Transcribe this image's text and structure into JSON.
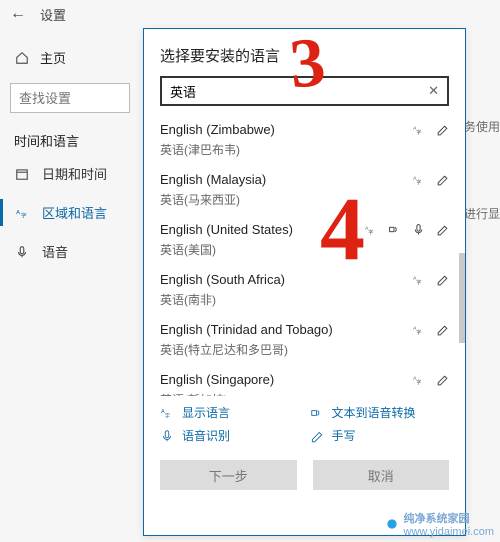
{
  "topbar": {
    "title": "设置"
  },
  "sidebar": {
    "home_label": "主页",
    "search_placeholder": "查找设置",
    "section_title": "时间和语言",
    "items": [
      {
        "label": "日期和时间"
      },
      {
        "label": "区域和语言"
      },
      {
        "label": "语音"
      }
    ]
  },
  "right_hints": {
    "a": "务使用",
    "b": "进行显"
  },
  "dialog": {
    "title": "选择要安装的语言",
    "search_value": "英语",
    "results": [
      {
        "name_en": "English (Zimbabwe)",
        "name_cn": "英语(津巴布韦)",
        "icons": [
          "disp",
          "hand"
        ]
      },
      {
        "name_en": "English (Malaysia)",
        "name_cn": "英语(马来西亚)",
        "icons": [
          "disp",
          "hand"
        ]
      },
      {
        "name_en": "English (United States)",
        "name_cn": "英语(美国)",
        "icons": [
          "disp",
          "tts",
          "speech",
          "hand"
        ]
      },
      {
        "name_en": "English (South Africa)",
        "name_cn": "英语(南非)",
        "icons": [
          "disp",
          "hand"
        ]
      },
      {
        "name_en": "English (Trinidad and Tobago)",
        "name_cn": "英语(特立尼达和多巴哥)",
        "icons": [
          "disp",
          "hand"
        ]
      },
      {
        "name_en": "English (Singapore)",
        "name_cn": "英语(新加坡)",
        "icons": [
          "disp",
          "hand"
        ]
      }
    ],
    "legend": {
      "display": "显示语言",
      "tts": "文本到语音转换",
      "speech": "语音识别",
      "hand": "手写"
    },
    "buttons": {
      "next": "下一步",
      "cancel": "取消"
    }
  },
  "watermark": {
    "brand": "纯净系统家园",
    "url": "www.yidaimei.com"
  }
}
